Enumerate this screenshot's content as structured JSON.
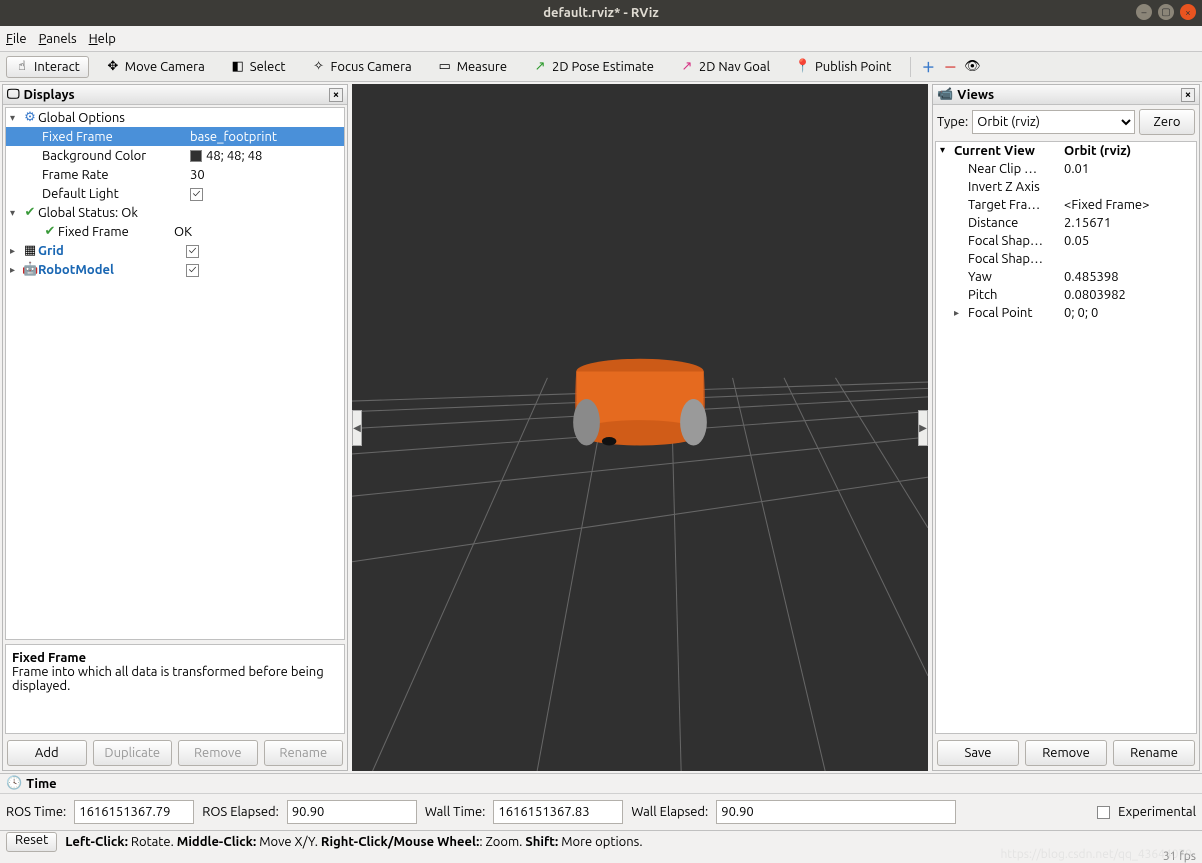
{
  "window": {
    "title": "default.rviz* - RViz"
  },
  "menu": {
    "file": "File",
    "panels": "Panels",
    "help": "Help"
  },
  "toolbar": {
    "interact": "Interact",
    "move_camera": "Move Camera",
    "select": "Select",
    "focus_camera": "Focus Camera",
    "measure": "Measure",
    "pose_estimate": "2D Pose Estimate",
    "nav_goal": "2D Nav Goal",
    "publish_point": "Publish Point"
  },
  "displays": {
    "title": "Displays",
    "global_options": "Global Options",
    "fixed_frame_label": "Fixed Frame",
    "fixed_frame_value": "base_footprint",
    "background_color_label": "Background Color",
    "background_color_value": "48; 48; 48",
    "frame_rate_label": "Frame Rate",
    "frame_rate_value": "30",
    "default_light_label": "Default Light",
    "global_status_label": "Global Status: Ok",
    "fixed_frame_status_label": "Fixed Frame",
    "fixed_frame_status_value": "OK",
    "grid_label": "Grid",
    "robot_model_label": "RobotModel",
    "help_title": "Fixed Frame",
    "help_text": "Frame into which all data is transformed before being displayed.",
    "btn_add": "Add",
    "btn_duplicate": "Duplicate",
    "btn_remove": "Remove",
    "btn_rename": "Rename"
  },
  "views": {
    "title": "Views",
    "type_label": "Type:",
    "type_value": "Orbit (rviz)",
    "zero_btn": "Zero",
    "current_view": "Current View",
    "current_view_value": "Orbit (rviz)",
    "props": [
      {
        "name": "Near Clip …",
        "value": "0.01"
      },
      {
        "name": "Invert Z Axis",
        "value": "",
        "checkbox": true,
        "checked": false
      },
      {
        "name": "Target Fra…",
        "value": "<Fixed Frame>"
      },
      {
        "name": "Distance",
        "value": "2.15671"
      },
      {
        "name": "Focal Shap…",
        "value": "0.05"
      },
      {
        "name": "Focal Shap…",
        "value": "",
        "checkbox": true,
        "checked": true
      },
      {
        "name": "Yaw",
        "value": "0.485398"
      },
      {
        "name": "Pitch",
        "value": "0.0803982"
      },
      {
        "name": "Focal Point",
        "value": "0; 0; 0",
        "expandable": true
      }
    ],
    "btn_save": "Save",
    "btn_remove": "Remove",
    "btn_rename": "Rename"
  },
  "time": {
    "title": "Time",
    "ros_time_label": "ROS Time:",
    "ros_time_value": "1616151367.79",
    "ros_elapsed_label": "ROS Elapsed:",
    "ros_elapsed_value": "90.90",
    "wall_time_label": "Wall Time:",
    "wall_time_value": "1616151367.83",
    "wall_elapsed_label": "Wall Elapsed:",
    "wall_elapsed_value": "90.90",
    "experimental_label": "Experimental"
  },
  "status": {
    "reset": "Reset",
    "hint_lc_b": "Left-Click:",
    "hint_lc": " Rotate. ",
    "hint_mc_b": "Middle-Click:",
    "hint_mc": " Move X/Y. ",
    "hint_rc_b": "Right-Click/Mouse Wheel:",
    "hint_rc": ": Zoom. ",
    "hint_sh_b": "Shift:",
    "hint_sh": " More options.",
    "fps": "31 fps"
  },
  "watermark": "https://blog.csdn.net/qq_43644079"
}
